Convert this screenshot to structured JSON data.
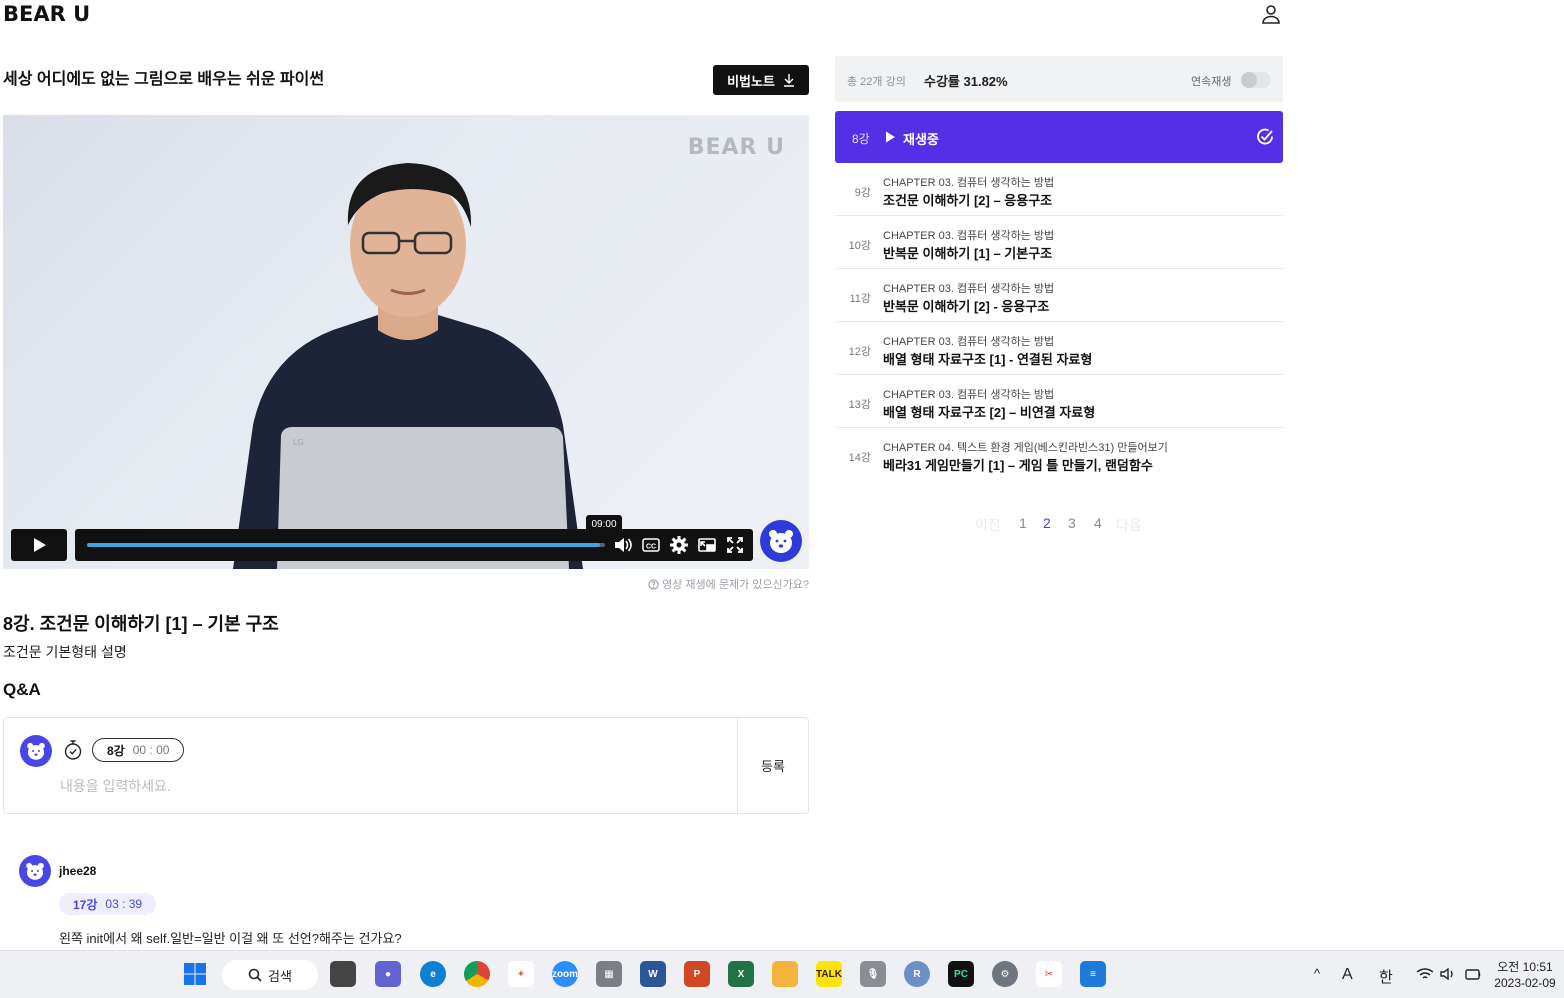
{
  "header": {
    "logo": "BEAR U",
    "user_icon": "user-icon"
  },
  "course": {
    "title": "세상 어디에도 없는 그림으로 배우는 쉬운 파이썬",
    "note_button": "비법노트"
  },
  "video": {
    "watermark": "BEAR U",
    "time_tooltip": "09:00",
    "progress": 0.99,
    "report_link": "영상 재생에 문제가 있으신가요?"
  },
  "lesson": {
    "title": "8강. 조건문 이해하기 [1] – 기본 구조",
    "description": "조건문 기본형태 설명"
  },
  "qa": {
    "heading": "Q&A",
    "lecture_tag": "8강",
    "timecode": "00 : 00",
    "placeholder": "내용을 입력하세요.",
    "submit_label": "등록"
  },
  "comment": {
    "user": "jhee28",
    "lecture_tag": "17강",
    "timecode": "03 : 39",
    "text": "왼쪽 init에서 왜 self.일반=일반 이걸 왜 또 선언?해주는 건가요?"
  },
  "sidebar": {
    "total": "총 22개 강의",
    "progress": "수강률 31.82%",
    "autoplay_label": "연속재생",
    "autoplay_on": false,
    "current": {
      "num": "8강",
      "status": "재생중"
    },
    "lessons": [
      {
        "num": "9강",
        "chapter": "CHAPTER 03. 컴퓨터 생각하는 방법",
        "name": "조건문 이해하기 [2] – 응용구조"
      },
      {
        "num": "10강",
        "chapter": "CHAPTER 03. 컴퓨터 생각하는 방법",
        "name": "반복문 이해하기 [1] – 기본구조"
      },
      {
        "num": "11강",
        "chapter": "CHAPTER 03. 컴퓨터 생각하는 방법",
        "name": "반복문 이해하기 [2] - 응용구조"
      },
      {
        "num": "12강",
        "chapter": "CHAPTER 03. 컴퓨터 생각하는 방법",
        "name": "배열 형태 자료구조 [1] - 연결된 자료형"
      },
      {
        "num": "13강",
        "chapter": "CHAPTER 03. 컴퓨터 생각하는 방법",
        "name": "배열 형태 자료구조 [2] – 비연결 자료형"
      },
      {
        "num": "14강",
        "chapter": "CHAPTER 04. 텍스트 환경 게임(베스킨라빈스31) 만들어보기",
        "name": "베라31 게임만들기 [1] – 게임 틀 만들기, 랜덤함수"
      }
    ],
    "pagination": {
      "prev": "이전",
      "pages": [
        "1",
        "2",
        "3",
        "4"
      ],
      "current": "2",
      "next": "다음"
    }
  },
  "taskbar": {
    "search_label": "검색",
    "tray_a": "A",
    "tray_ime": "한",
    "clock_time": "오전 10:51",
    "clock_date": "2023-02-09"
  },
  "colors": {
    "accent": "#5330e6",
    "progress_bar": "#3ea6e0",
    "bear_blue": "#4946e8"
  }
}
